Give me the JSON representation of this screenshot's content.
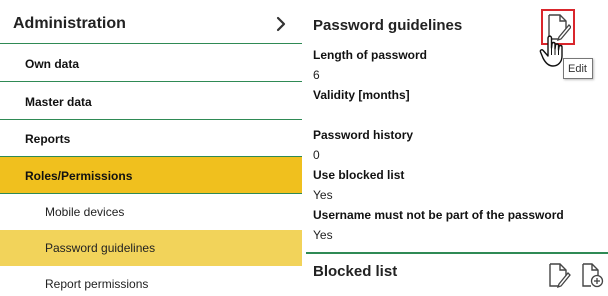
{
  "nav": {
    "title": "Administration",
    "items": [
      {
        "label": "Own data"
      },
      {
        "label": "Master data"
      },
      {
        "label": "Reports"
      },
      {
        "label": "Roles/Permissions"
      }
    ],
    "subitems": [
      {
        "label": "Mobile devices"
      },
      {
        "label": "Password guidelines"
      },
      {
        "label": "Report permissions"
      }
    ]
  },
  "panel": {
    "title": "Password guidelines",
    "fields": [
      {
        "label": "Length of password",
        "value": "6"
      },
      {
        "label": "Validity [months]",
        "value": ""
      },
      {
        "label": "Password history",
        "value": "0"
      },
      {
        "label": "Use blocked list",
        "value": "Yes"
      },
      {
        "label": "Username must not be part of the password",
        "value": "Yes"
      }
    ],
    "tooltip": "Edit",
    "blocked_title": "Blocked list"
  },
  "colors": {
    "accent_green": "#2f8a55",
    "active_yellow": "#f0c01e",
    "selected_yellow": "#f2d35a",
    "highlight_red": "#d9262c"
  }
}
